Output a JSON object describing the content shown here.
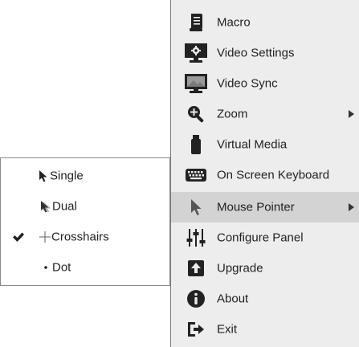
{
  "main_menu": {
    "items": [
      {
        "label": "Macro",
        "icon": "macro-icon"
      },
      {
        "label": "Video Settings",
        "icon": "video-settings-icon"
      },
      {
        "label": "Video Sync",
        "icon": "video-sync-icon"
      },
      {
        "label": "Zoom",
        "icon": "zoom-icon",
        "has_submenu": true
      },
      {
        "label": "Virtual Media",
        "icon": "usb-drive-icon"
      },
      {
        "label": "On Screen Keyboard",
        "icon": "keyboard-icon"
      },
      {
        "label": "Mouse Pointer",
        "icon": "mouse-pointer-icon",
        "has_submenu": true,
        "active": true
      },
      {
        "label": "Configure Panel",
        "icon": "sliders-icon"
      },
      {
        "label": "Upgrade",
        "icon": "upgrade-icon"
      },
      {
        "label": "About",
        "icon": "info-icon"
      },
      {
        "label": "Exit",
        "icon": "exit-icon"
      }
    ],
    "active_color": "#d3d3d3",
    "background_color": "#ededed"
  },
  "mouse_pointer_submenu": {
    "items": [
      {
        "label": "Single",
        "icon": "arrow-pointer-icon",
        "checked": false
      },
      {
        "label": "Dual",
        "icon": "dual-pointer-icon",
        "checked": false
      },
      {
        "label": "Crosshairs",
        "icon": "crosshairs-icon",
        "checked": true
      },
      {
        "label": "Dot",
        "icon": "dot-pointer-icon",
        "checked": false
      }
    ]
  }
}
